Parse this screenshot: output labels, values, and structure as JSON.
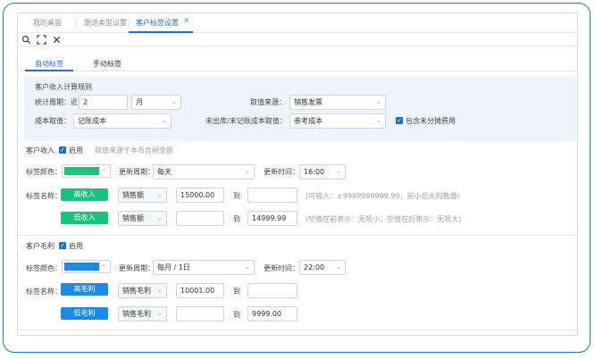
{
  "tabs": [
    {
      "label": "我的桌面"
    },
    {
      "label": "跟进类型设置"
    },
    {
      "label": "客户标签设置",
      "active": true
    }
  ],
  "toolbar": {
    "icons": [
      "search-icon",
      "expand-icon",
      "close-icon"
    ]
  },
  "subtabs": [
    {
      "label": "自动标签",
      "active": true
    },
    {
      "label": "手动标签"
    }
  ],
  "income_rule": {
    "title": "客户收入计算规则",
    "period_label": "统计周期：近",
    "period_value": "2",
    "period_unit": "月",
    "source_label": "取值来源：",
    "source_value": "销售发票",
    "cost_label": "成本取值：",
    "cost_value": "记账成本",
    "unout_label": "未出库/未记账成本取值：",
    "unout_value": "参考成本",
    "include_label": "包含未分摊费用",
    "include_checked": true
  },
  "income_section": {
    "title": "客户收入",
    "enable_label": "启用",
    "enabled": true,
    "note": "取值来源于本币含税金额",
    "color_label": "标签颜色：",
    "color": "#19c37d",
    "update_cycle_label": "更新周期：",
    "update_cycle_value": "每天",
    "update_time_label": "更新时间：",
    "update_time_value": "16:00",
    "tag_name_label": "标签名称：",
    "rows": [
      {
        "tag": "高收入",
        "metric": "销售额",
        "from": "15000.00",
        "to_label": "到",
        "to": "",
        "hint": "(可输入：±9999999999.99，前小后大的数值)"
      },
      {
        "tag": "低收入",
        "metric": "销售额",
        "from": "",
        "to_label": "到",
        "to": "14999.99",
        "hint": "(空值在前表示：无限小；空值在后表示：无限大)"
      }
    ]
  },
  "profit_section": {
    "title": "客户毛利",
    "enable_label": "启用",
    "enabled": true,
    "color_label": "标签颜色：",
    "color": "#1e88e5",
    "update_cycle_label": "更新周期：",
    "update_cycle_value": "每月 / 1日",
    "update_time_label": "更新时间：",
    "update_time_value": "22:00",
    "tag_name_label": "标签名称：",
    "rows": [
      {
        "tag": "高毛利",
        "metric": "销售毛利",
        "from": "10001.00",
        "to_label": "到",
        "to": ""
      },
      {
        "tag": "低毛利",
        "metric": "销售毛利",
        "from": "",
        "to_label": "到",
        "to": "9999.00"
      }
    ]
  }
}
